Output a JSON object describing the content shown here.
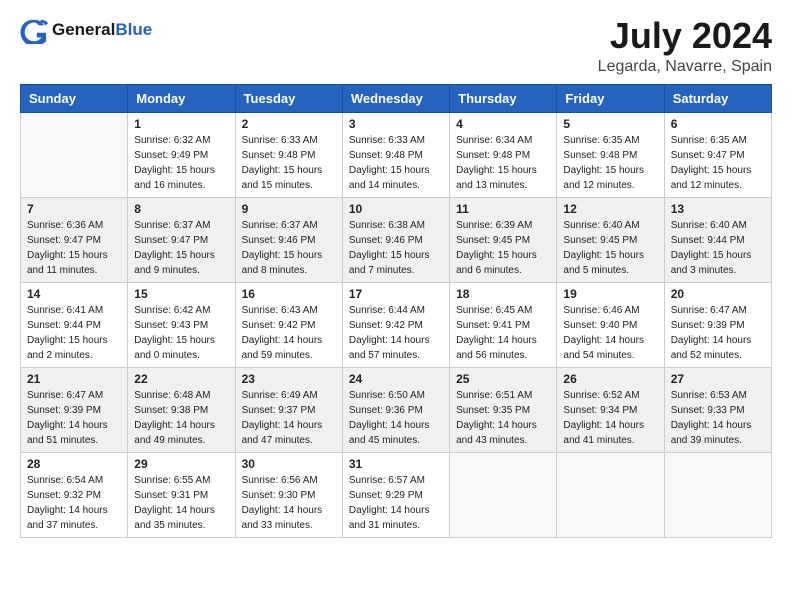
{
  "logo": {
    "general": "General",
    "blue": "Blue"
  },
  "title": "July 2024",
  "subtitle": "Legarda, Navarre, Spain",
  "days_of_week": [
    "Sunday",
    "Monday",
    "Tuesday",
    "Wednesday",
    "Thursday",
    "Friday",
    "Saturday"
  ],
  "weeks": [
    [
      {
        "day": "",
        "sunrise": "",
        "sunset": "",
        "daylight": ""
      },
      {
        "day": "1",
        "sunrise": "Sunrise: 6:32 AM",
        "sunset": "Sunset: 9:49 PM",
        "daylight": "Daylight: 15 hours and 16 minutes."
      },
      {
        "day": "2",
        "sunrise": "Sunrise: 6:33 AM",
        "sunset": "Sunset: 9:48 PM",
        "daylight": "Daylight: 15 hours and 15 minutes."
      },
      {
        "day": "3",
        "sunrise": "Sunrise: 6:33 AM",
        "sunset": "Sunset: 9:48 PM",
        "daylight": "Daylight: 15 hours and 14 minutes."
      },
      {
        "day": "4",
        "sunrise": "Sunrise: 6:34 AM",
        "sunset": "Sunset: 9:48 PM",
        "daylight": "Daylight: 15 hours and 13 minutes."
      },
      {
        "day": "5",
        "sunrise": "Sunrise: 6:35 AM",
        "sunset": "Sunset: 9:48 PM",
        "daylight": "Daylight: 15 hours and 12 minutes."
      },
      {
        "day": "6",
        "sunrise": "Sunrise: 6:35 AM",
        "sunset": "Sunset: 9:47 PM",
        "daylight": "Daylight: 15 hours and 12 minutes."
      }
    ],
    [
      {
        "day": "7",
        "sunrise": "Sunrise: 6:36 AM",
        "sunset": "Sunset: 9:47 PM",
        "daylight": "Daylight: 15 hours and 11 minutes."
      },
      {
        "day": "8",
        "sunrise": "Sunrise: 6:37 AM",
        "sunset": "Sunset: 9:47 PM",
        "daylight": "Daylight: 15 hours and 9 minutes."
      },
      {
        "day": "9",
        "sunrise": "Sunrise: 6:37 AM",
        "sunset": "Sunset: 9:46 PM",
        "daylight": "Daylight: 15 hours and 8 minutes."
      },
      {
        "day": "10",
        "sunrise": "Sunrise: 6:38 AM",
        "sunset": "Sunset: 9:46 PM",
        "daylight": "Daylight: 15 hours and 7 minutes."
      },
      {
        "day": "11",
        "sunrise": "Sunrise: 6:39 AM",
        "sunset": "Sunset: 9:45 PM",
        "daylight": "Daylight: 15 hours and 6 minutes."
      },
      {
        "day": "12",
        "sunrise": "Sunrise: 6:40 AM",
        "sunset": "Sunset: 9:45 PM",
        "daylight": "Daylight: 15 hours and 5 minutes."
      },
      {
        "day": "13",
        "sunrise": "Sunrise: 6:40 AM",
        "sunset": "Sunset: 9:44 PM",
        "daylight": "Daylight: 15 hours and 3 minutes."
      }
    ],
    [
      {
        "day": "14",
        "sunrise": "Sunrise: 6:41 AM",
        "sunset": "Sunset: 9:44 PM",
        "daylight": "Daylight: 15 hours and 2 minutes."
      },
      {
        "day": "15",
        "sunrise": "Sunrise: 6:42 AM",
        "sunset": "Sunset: 9:43 PM",
        "daylight": "Daylight: 15 hours and 0 minutes."
      },
      {
        "day": "16",
        "sunrise": "Sunrise: 6:43 AM",
        "sunset": "Sunset: 9:42 PM",
        "daylight": "Daylight: 14 hours and 59 minutes."
      },
      {
        "day": "17",
        "sunrise": "Sunrise: 6:44 AM",
        "sunset": "Sunset: 9:42 PM",
        "daylight": "Daylight: 14 hours and 57 minutes."
      },
      {
        "day": "18",
        "sunrise": "Sunrise: 6:45 AM",
        "sunset": "Sunset: 9:41 PM",
        "daylight": "Daylight: 14 hours and 56 minutes."
      },
      {
        "day": "19",
        "sunrise": "Sunrise: 6:46 AM",
        "sunset": "Sunset: 9:40 PM",
        "daylight": "Daylight: 14 hours and 54 minutes."
      },
      {
        "day": "20",
        "sunrise": "Sunrise: 6:47 AM",
        "sunset": "Sunset: 9:39 PM",
        "daylight": "Daylight: 14 hours and 52 minutes."
      }
    ],
    [
      {
        "day": "21",
        "sunrise": "Sunrise: 6:47 AM",
        "sunset": "Sunset: 9:39 PM",
        "daylight": "Daylight: 14 hours and 51 minutes."
      },
      {
        "day": "22",
        "sunrise": "Sunrise: 6:48 AM",
        "sunset": "Sunset: 9:38 PM",
        "daylight": "Daylight: 14 hours and 49 minutes."
      },
      {
        "day": "23",
        "sunrise": "Sunrise: 6:49 AM",
        "sunset": "Sunset: 9:37 PM",
        "daylight": "Daylight: 14 hours and 47 minutes."
      },
      {
        "day": "24",
        "sunrise": "Sunrise: 6:50 AM",
        "sunset": "Sunset: 9:36 PM",
        "daylight": "Daylight: 14 hours and 45 minutes."
      },
      {
        "day": "25",
        "sunrise": "Sunrise: 6:51 AM",
        "sunset": "Sunset: 9:35 PM",
        "daylight": "Daylight: 14 hours and 43 minutes."
      },
      {
        "day": "26",
        "sunrise": "Sunrise: 6:52 AM",
        "sunset": "Sunset: 9:34 PM",
        "daylight": "Daylight: 14 hours and 41 minutes."
      },
      {
        "day": "27",
        "sunrise": "Sunrise: 6:53 AM",
        "sunset": "Sunset: 9:33 PM",
        "daylight": "Daylight: 14 hours and 39 minutes."
      }
    ],
    [
      {
        "day": "28",
        "sunrise": "Sunrise: 6:54 AM",
        "sunset": "Sunset: 9:32 PM",
        "daylight": "Daylight: 14 hours and 37 minutes."
      },
      {
        "day": "29",
        "sunrise": "Sunrise: 6:55 AM",
        "sunset": "Sunset: 9:31 PM",
        "daylight": "Daylight: 14 hours and 35 minutes."
      },
      {
        "day": "30",
        "sunrise": "Sunrise: 6:56 AM",
        "sunset": "Sunset: 9:30 PM",
        "daylight": "Daylight: 14 hours and 33 minutes."
      },
      {
        "day": "31",
        "sunrise": "Sunrise: 6:57 AM",
        "sunset": "Sunset: 9:29 PM",
        "daylight": "Daylight: 14 hours and 31 minutes."
      },
      {
        "day": "",
        "sunrise": "",
        "sunset": "",
        "daylight": ""
      },
      {
        "day": "",
        "sunrise": "",
        "sunset": "",
        "daylight": ""
      },
      {
        "day": "",
        "sunrise": "",
        "sunset": "",
        "daylight": ""
      }
    ]
  ]
}
